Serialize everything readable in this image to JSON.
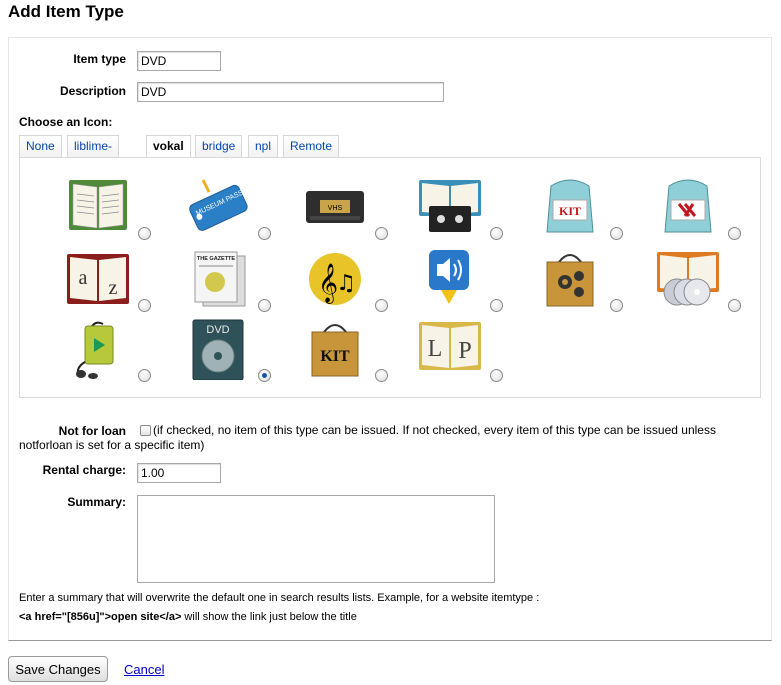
{
  "page_title": "Add Item Type",
  "form": {
    "item_type_label": "Item type",
    "item_type_value": "DVD",
    "description_label": "Description",
    "description_value": "DVD",
    "choose_icon_label": "Choose an Icon:",
    "tabs": [
      {
        "label": "None"
      },
      {
        "label": "liblime-kids"
      },
      {
        "label": "vokal"
      },
      {
        "label": "bridge"
      },
      {
        "label": "npl"
      },
      {
        "label": "Remote Image"
      }
    ],
    "active_tab": "vokal",
    "icons": [
      {
        "name": "book-icon"
      },
      {
        "name": "museum-pass-icon",
        "text": "MUSEUM PASS"
      },
      {
        "name": "vhs-tape-icon",
        "text": "VHS"
      },
      {
        "name": "book-cassette-icon"
      },
      {
        "name": "backpack-kit-icon",
        "text": "KIT"
      },
      {
        "name": "backpack-tools-icon"
      },
      {
        "name": "a-z-book-icon",
        "text_a": "a",
        "text_z": "z"
      },
      {
        "name": "newspaper-icon",
        "text": "THE GAZETTE"
      },
      {
        "name": "music-notes-icon"
      },
      {
        "name": "audio-download-icon"
      },
      {
        "name": "gear-bag-icon"
      },
      {
        "name": "book-cds-icon"
      },
      {
        "name": "audio-player-icon"
      },
      {
        "name": "dvd-case-icon",
        "text": "DVD"
      },
      {
        "name": "kit-bag-icon",
        "text": "KIT"
      },
      {
        "name": "large-print-book-icon",
        "text_l": "L",
        "text_p": "P"
      }
    ],
    "selected_icon_index": 13,
    "not_for_loan_label": "Not for loan",
    "not_for_loan_note": "(if checked, no item of this type can be issued. If not checked, every item of this type can be issued unless notforloan is set for a specific item)",
    "rental_charge_label": "Rental charge:",
    "rental_charge_value": "1.00",
    "summary_label": "Summary:",
    "summary_value": "",
    "summary_hint_line1": "Enter a summary that will overwrite the default one in search results lists. Example, for a website itemtype :",
    "summary_hint_code": "<a href=\"[856u]\">open site</a>",
    "summary_hint_line2_suffix": " will show the link just below the title"
  },
  "actions": {
    "save_label": "Save Changes",
    "cancel_label": "Cancel"
  }
}
